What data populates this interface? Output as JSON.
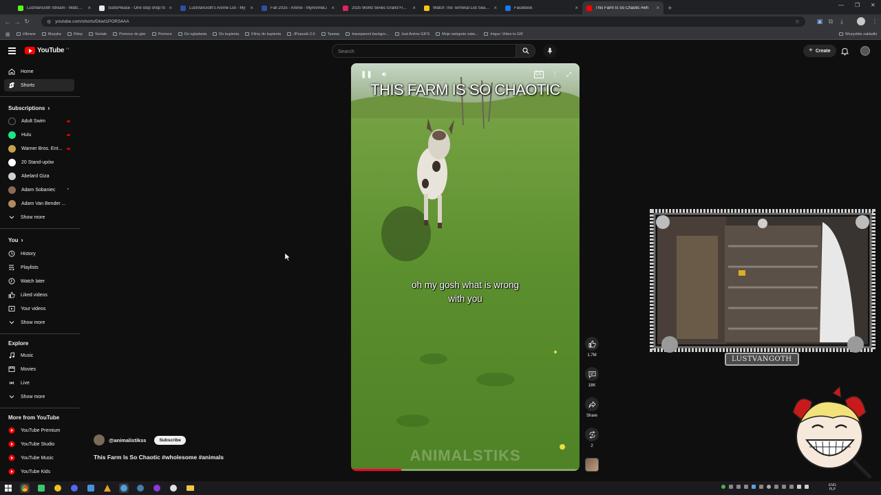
{
  "browser": {
    "tabs": [
      {
        "label": "LustVanGoth Stream - Watch Li",
        "color": "#53fc18"
      },
      {
        "label": "SubsPlease - One stop shop fo",
        "color": "#e8eaed"
      },
      {
        "label": "LustVanGoth's Anime List - My",
        "color": "#2e51a2"
      },
      {
        "label": "Fall 2025 - Anime - MyAnimeLi",
        "color": "#2e51a2"
      },
      {
        "label": "2025 World Series Grand Finale",
        "color": "#e0245e"
      },
      {
        "label": "Watch The Terminal List Season",
        "color": "#f5c518"
      },
      {
        "label": "Facebook",
        "color": "#1877f2"
      },
      {
        "label": "This Farm Is So Chaotic #wh",
        "color": "#ff0000"
      }
    ],
    "new_tab_label": "+",
    "url": "youtube.com/shorts/Dkwt1PORS4AA",
    "bookmarks": [
      "Ulbrane",
      "Muzyka",
      "Filmy",
      "Seriale",
      "Pomoce do gier",
      "Pomoce",
      "Do ogladania",
      "Do kupienia",
      "Filmy do kupienia",
      "JPopuski 2.0",
      "Трекер",
      "transparent backgro...",
      "Just Anime GIFS",
      "Moje wstępnie zatw...",
      "Imgur: Video to GIF"
    ],
    "bookmarks_right": "Wszystkie zakładki"
  },
  "youtube": {
    "logo_text": "YouTube",
    "logo_suffix": "PL",
    "search_placeholder": "Search",
    "create_label": "Create",
    "sidebar": {
      "main": [
        {
          "label": "Home",
          "icon": "home-icon"
        },
        {
          "label": "Shorts",
          "icon": "shorts-icon"
        }
      ],
      "subscriptions_heading": "Subscriptions",
      "subscriptions": [
        {
          "label": "Adult Swim",
          "color": "#111111",
          "live": true
        },
        {
          "label": "Hulu",
          "color": "#1ce783",
          "live": true
        },
        {
          "label": "Warner Bros. Ent...",
          "color": "#c8a24a",
          "live": true
        },
        {
          "label": "20 Stand-upów",
          "color": "#ffffff",
          "live": false
        },
        {
          "label": "Abelard Giza",
          "color": "#d0d0d0",
          "live": false
        },
        {
          "label": "Adam Sobaniec",
          "color": "#8a6a5a",
          "live": false,
          "dot": "•"
        },
        {
          "label": "Adam Van Bender ...",
          "color": "#b08a60",
          "live": false
        }
      ],
      "show_more_label": "Show more",
      "you_heading": "You",
      "you": [
        {
          "label": "History",
          "icon": "history-icon"
        },
        {
          "label": "Playlists",
          "icon": "playlists-icon"
        },
        {
          "label": "Watch later",
          "icon": "watch-later-icon"
        },
        {
          "label": "Liked videos",
          "icon": "like-icon"
        },
        {
          "label": "Your videos",
          "icon": "your-videos-icon"
        }
      ],
      "explore_heading": "Explore",
      "explore": [
        {
          "label": "Music",
          "icon": "music-icon"
        },
        {
          "label": "Movies",
          "icon": "movies-icon"
        },
        {
          "label": "Live",
          "icon": "live-icon"
        }
      ],
      "more_heading": "More from YouTube",
      "more": [
        {
          "label": "YouTube Premium"
        },
        {
          "label": "YouTube Studio"
        },
        {
          "label": "YouTube Music"
        },
        {
          "label": "YouTube Kids"
        }
      ]
    },
    "short": {
      "overlay_title": "THIS FARM IS SO CHAOTIC",
      "caption_line1": "oh my gosh what is wrong",
      "caption_line2": "with you",
      "watermark": "ANIMALSTIKS",
      "channel": "@animalistikss",
      "subscribe_label": "Subscribe",
      "title": "This Farm Is So Chaotic #wholesome #animals",
      "progress": 0.22
    },
    "actions": {
      "likes": "1.7M",
      "comments": "18K",
      "share_label": "Share",
      "remix": "2"
    }
  },
  "stream_overlay": {
    "name": "LUSTVANGOTH"
  },
  "taskbar": {
    "lang_top": "ENG",
    "lang_bottom": "PLP"
  }
}
